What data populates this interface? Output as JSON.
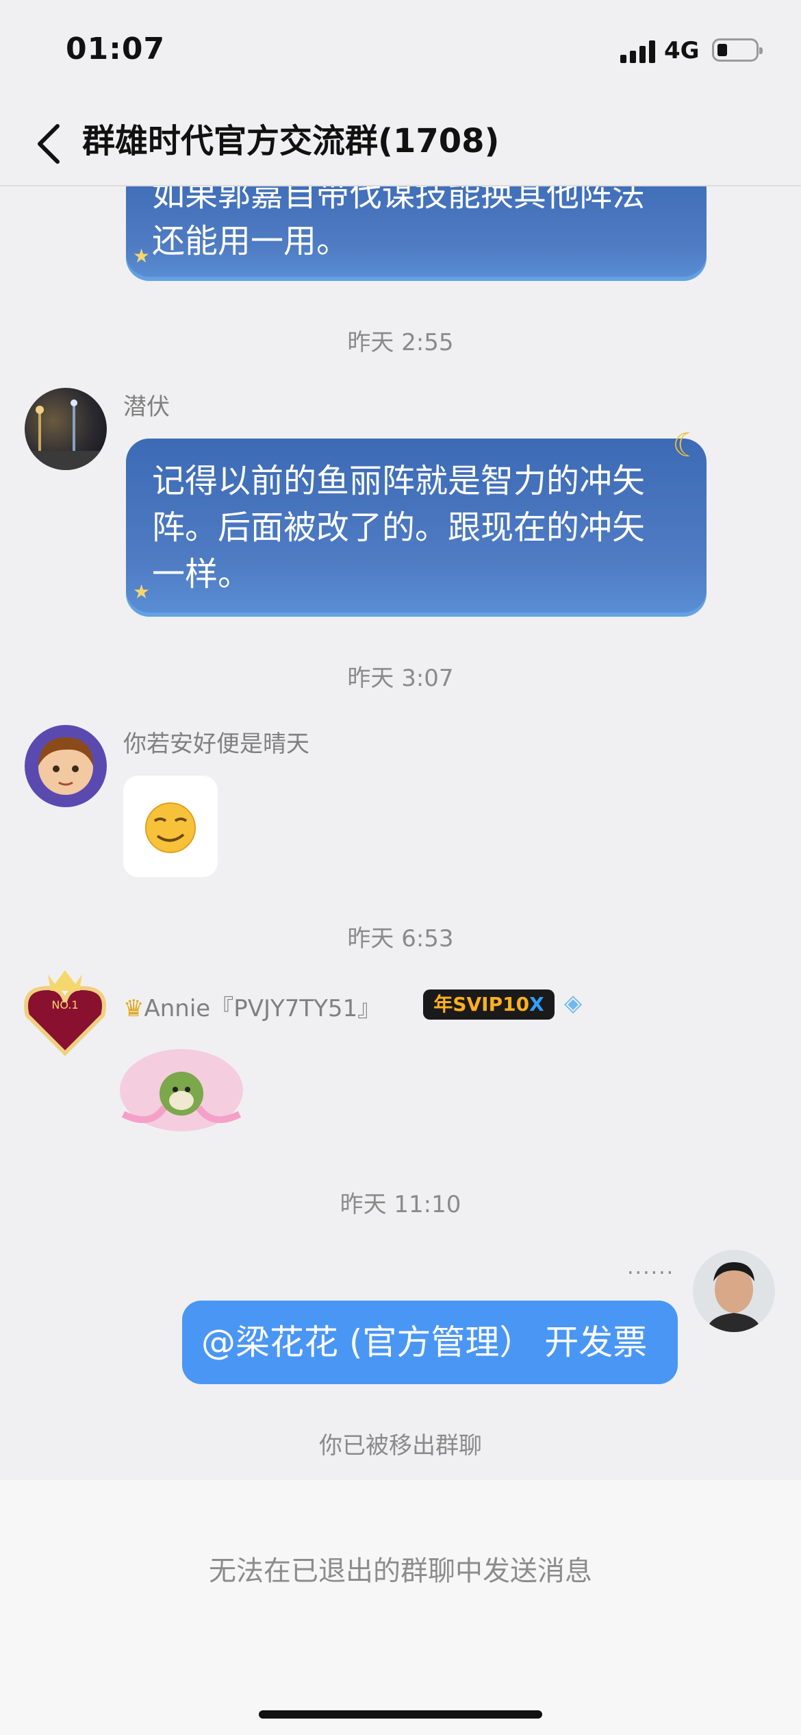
{
  "status_bar": {
    "time": "01:07",
    "network": "4G"
  },
  "header": {
    "title": "群雄时代官方交流群(1708)"
  },
  "messages": [
    {
      "text_partial_line": "如果郭嘉自带伐谋技能换其他阵法",
      "text_line2": "还能用一用。"
    },
    {
      "timestamp": "昨天 2:55",
      "sender": "潜伏",
      "lines": [
        "记得以前的鱼丽阵就是智力的冲矢",
        "阵。后面被改了的。跟现在的冲矢",
        "一样。"
      ]
    },
    {
      "timestamp": "昨天 3:07",
      "sender": "你若安好便是晴天"
    },
    {
      "timestamp": "昨天 6:53",
      "sender": "Annie『PVJY7TY51』",
      "badge": "年SVIP10"
    },
    {
      "timestamp": "昨天 11:10",
      "self_text": "@梁花花 (官方管理）  开发票",
      "status_dots": "......"
    }
  ],
  "system_note": "你已被移出群聊",
  "bottom": {
    "disabled_message": "无法在已退出的群聊中发送消息"
  },
  "colors": {
    "self_bubble": "#4a96f4",
    "theme_bubble": "#4f7cc3",
    "background": "#f0f0f2"
  }
}
